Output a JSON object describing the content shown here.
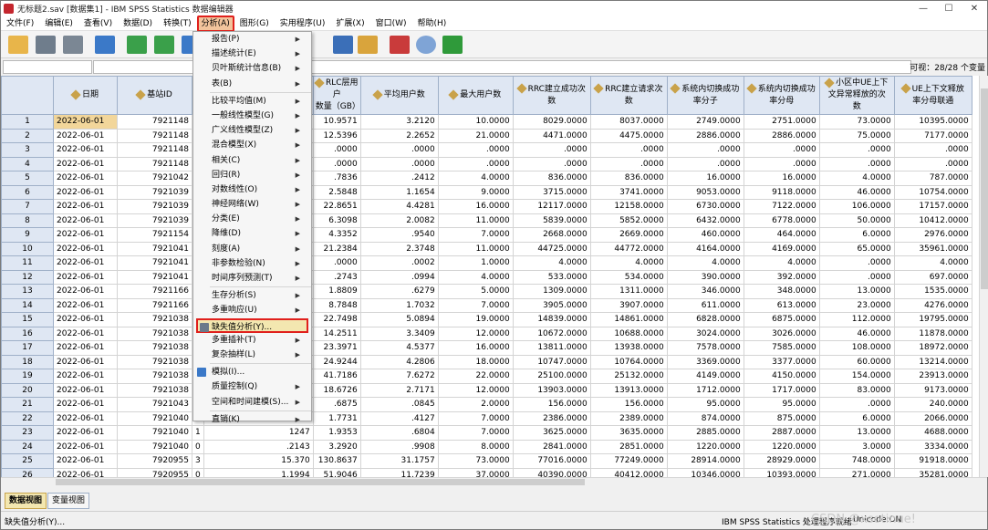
{
  "window": {
    "title": "无标题2.sav [数据集1] - IBM SPSS Statistics 数据编辑器",
    "min": "—",
    "max": "☐",
    "close": "✕"
  },
  "menubar": [
    "文件(F)",
    "编辑(E)",
    "查看(V)",
    "数据(D)",
    "转换(T)",
    "分析(A)",
    "图形(G)",
    "实用程序(U)",
    "扩展(X)",
    "窗口(W)",
    "帮助(H)"
  ],
  "cellbar": {
    "visible": "可视：28/28 个变量"
  },
  "columns": [
    "",
    "日期",
    "基站ID",
    "",
    "",
    "RLC层用户\n数量（GB）",
    "平均用户数",
    "最大用户数",
    "RRC建立成功次\n数",
    "RRC建立请求次\n数",
    "系统内切换成功\n率分子",
    "系统内切换成功\n率分母",
    "小区中UE上下\n文异常释放的次\n数",
    "UE上下文释放\n率分母联通"
  ],
  "rows": [
    [
      "1",
      "2022-06-01",
      "7921148",
      "",
      "",
      "10.9571",
      "3.2120",
      "10.0000",
      "8029.0000",
      "8037.0000",
      "2749.0000",
      "2751.0000",
      "73.0000",
      "10395.0000"
    ],
    [
      "2",
      "2022-06-01",
      "7921148",
      "",
      "",
      "12.5396",
      "2.2652",
      "21.0000",
      "4471.0000",
      "4475.0000",
      "2886.0000",
      "2886.0000",
      "75.0000",
      "7177.0000"
    ],
    [
      "3",
      "2022-06-01",
      "7921148",
      "",
      "",
      ".0000",
      ".0000",
      ".0000",
      ".0000",
      ".0000",
      ".0000",
      ".0000",
      ".0000",
      ".0000"
    ],
    [
      "4",
      "2022-06-01",
      "7921148",
      "",
      "",
      ".0000",
      ".0000",
      ".0000",
      ".0000",
      ".0000",
      ".0000",
      ".0000",
      ".0000",
      ".0000"
    ],
    [
      "5",
      "2022-06-01",
      "7921042",
      "",
      "",
      ".7836",
      ".2412",
      "4.0000",
      "836.0000",
      "836.0000",
      "16.0000",
      "16.0000",
      "4.0000",
      "787.0000"
    ],
    [
      "6",
      "2022-06-01",
      "7921039",
      "",
      "",
      "2.5848",
      "1.1654",
      "9.0000",
      "3715.0000",
      "3741.0000",
      "9053.0000",
      "9118.0000",
      "46.0000",
      "10754.0000"
    ],
    [
      "7",
      "2022-06-01",
      "7921039",
      "",
      "",
      "22.8651",
      "4.4281",
      "16.0000",
      "12117.0000",
      "12158.0000",
      "6730.0000",
      "7122.0000",
      "106.0000",
      "17157.0000"
    ],
    [
      "8",
      "2022-06-01",
      "7921039",
      "",
      "",
      "6.3098",
      "2.0082",
      "11.0000",
      "5839.0000",
      "5852.0000",
      "6432.0000",
      "6778.0000",
      "50.0000",
      "10412.0000"
    ],
    [
      "9",
      "2022-06-01",
      "7921154",
      "",
      "",
      "4.3352",
      ".9540",
      "7.0000",
      "2668.0000",
      "2669.0000",
      "460.0000",
      "464.0000",
      "6.0000",
      "2976.0000"
    ],
    [
      "10",
      "2022-06-01",
      "7921041",
      "",
      "",
      "21.2384",
      "2.3748",
      "11.0000",
      "44725.0000",
      "44772.0000",
      "4164.0000",
      "4169.0000",
      "65.0000",
      "35961.0000"
    ],
    [
      "11",
      "2022-06-01",
      "7921041",
      "",
      "",
      ".0000",
      ".0002",
      "1.0000",
      "4.0000",
      "4.0000",
      "4.0000",
      "4.0000",
      ".0000",
      "4.0000"
    ],
    [
      "12",
      "2022-06-01",
      "7921041",
      "",
      "",
      ".2743",
      ".0994",
      "4.0000",
      "533.0000",
      "534.0000",
      "390.0000",
      "392.0000",
      ".0000",
      "697.0000"
    ],
    [
      "13",
      "2022-06-01",
      "7921166",
      "",
      "",
      "1.8809",
      ".6279",
      "5.0000",
      "1309.0000",
      "1311.0000",
      "346.0000",
      "348.0000",
      "13.0000",
      "1535.0000"
    ],
    [
      "14",
      "2022-06-01",
      "7921166",
      "",
      "",
      "8.7848",
      "1.7032",
      "7.0000",
      "3905.0000",
      "3907.0000",
      "611.0000",
      "613.0000",
      "23.0000",
      "4276.0000"
    ],
    [
      "15",
      "2022-06-01",
      "7921038",
      "",
      "",
      "22.7498",
      "5.0894",
      "19.0000",
      "14839.0000",
      "14861.0000",
      "6828.0000",
      "6875.0000",
      "112.0000",
      "19795.0000"
    ],
    [
      "16",
      "2022-06-01",
      "7921038",
      "",
      "",
      "14.2511",
      "3.3409",
      "12.0000",
      "10672.0000",
      "10688.0000",
      "3024.0000",
      "3026.0000",
      "46.0000",
      "11878.0000"
    ],
    [
      "17",
      "2022-06-01",
      "7921038",
      "",
      "",
      "23.3971",
      "4.5377",
      "16.0000",
      "13811.0000",
      "13938.0000",
      "7578.0000",
      "7585.0000",
      "108.0000",
      "18972.0000"
    ],
    [
      "18",
      "2022-06-01",
      "7921038",
      "",
      "",
      "24.9244",
      "4.2806",
      "18.0000",
      "10747.0000",
      "10764.0000",
      "3369.0000",
      "3377.0000",
      "60.0000",
      "13214.0000"
    ],
    [
      "19",
      "2022-06-01",
      "7921038",
      "",
      "",
      "41.7186",
      "7.6272",
      "22.0000",
      "25100.0000",
      "25132.0000",
      "4149.0000",
      "4150.0000",
      "154.0000",
      "23913.0000"
    ],
    [
      "20",
      "2022-06-01",
      "7921038",
      "",
      "",
      "18.6726",
      "2.7171",
      "12.0000",
      "13903.0000",
      "13913.0000",
      "1712.0000",
      "1717.0000",
      "83.0000",
      "9173.0000"
    ],
    [
      "21",
      "2022-06-01",
      "7921043",
      "",
      "",
      ".6875",
      ".0845",
      "2.0000",
      "156.0000",
      "156.0000",
      "95.0000",
      "95.0000",
      ".0000",
      "240.0000"
    ],
    [
      "22",
      "2022-06-01",
      "7921040",
      "",
      "",
      "1.7731",
      ".4127",
      "7.0000",
      "2386.0000",
      "2389.0000",
      "874.0000",
      "875.0000",
      "6.0000",
      "2066.0000"
    ],
    [
      "23",
      "2022-06-01",
      "7921040",
      "1",
      "1247",
      "1.9353",
      ".6804",
      "7.0000",
      "3625.0000",
      "3635.0000",
      "2885.0000",
      "2887.0000",
      "13.0000",
      "4688.0000"
    ],
    [
      "24",
      "2022-06-01",
      "7921040",
      "0",
      ".2143",
      "3.2920",
      ".9908",
      "8.0000",
      "2841.0000",
      "2851.0000",
      "1220.0000",
      "1220.0000",
      "3.0000",
      "3334.0000"
    ],
    [
      "25",
      "2022-06-01",
      "7920955",
      "3",
      "15.370",
      "130.8637",
      "31.1757",
      "73.0000",
      "77016.0000",
      "77249.0000",
      "28914.0000",
      "28929.0000",
      "748.0000",
      "91918.0000"
    ],
    [
      "26",
      "2022-06-01",
      "7920955",
      "0",
      "1.1994",
      "51.9046",
      "11.7239",
      "37.0000",
      "40390.0000",
      "40412.0000",
      "10346.0000",
      "10393.0000",
      "271.0000",
      "35281.0000"
    ]
  ],
  "menu": {
    "items": [
      {
        "label": "报告(P)",
        "sub": true
      },
      {
        "label": "描述统计(E)",
        "sub": true
      },
      {
        "label": "贝叶斯统计信息(B)",
        "sub": true
      },
      {
        "label": "表(B)",
        "sub": true
      },
      {
        "label": "比较平均值(M)",
        "sub": true
      },
      {
        "label": "一般线性模型(G)",
        "sub": true
      },
      {
        "label": "广义线性模型(Z)",
        "sub": true
      },
      {
        "label": "混合模型(X)",
        "sub": true
      },
      {
        "label": "相关(C)",
        "sub": true
      },
      {
        "label": "回归(R)",
        "sub": true
      },
      {
        "label": "对数线性(O)",
        "sub": true
      },
      {
        "label": "神经网络(W)",
        "sub": true
      },
      {
        "label": "分类(E)",
        "sub": true
      },
      {
        "label": "降维(D)",
        "sub": true
      },
      {
        "label": "刻度(A)",
        "sub": true
      },
      {
        "label": "非参数检验(N)",
        "sub": true
      },
      {
        "label": "时间序列预测(T)",
        "sub": true
      },
      {
        "label": "生存分析(S)",
        "sub": true
      },
      {
        "label": "多重响应(U)",
        "sub": true
      },
      {
        "label": "缺失值分析(Y)...",
        "sub": false,
        "selected": true
      },
      {
        "label": "多重插补(T)",
        "sub": true
      },
      {
        "label": "复杂抽样(L)",
        "sub": true
      },
      {
        "label": "模拟(I)...",
        "sub": false
      },
      {
        "label": "质量控制(Q)",
        "sub": true
      },
      {
        "label": "空间和时间建模(S)...",
        "sub": true
      },
      {
        "label": "直销(K)",
        "sub": true
      }
    ]
  },
  "tabs": [
    "数据视图",
    "变量视图"
  ],
  "status": {
    "text": "缺失值分析(Y)...",
    "processor": "IBM SPSS Statistics 处理程序就绪",
    "unicode": "Unicode:ON",
    "watermark": "CSDN @xsotinue!"
  }
}
